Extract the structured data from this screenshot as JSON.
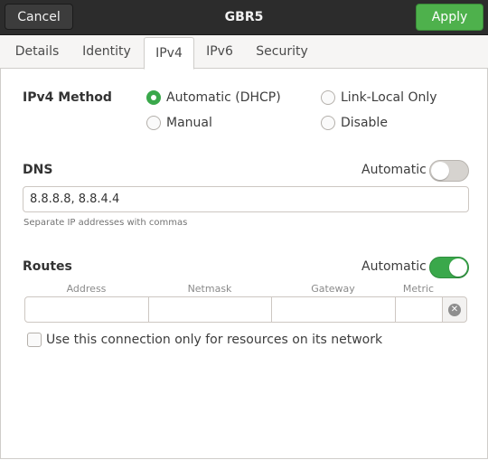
{
  "header": {
    "cancel_label": "Cancel",
    "title": "GBR5",
    "apply_label": "Apply"
  },
  "tabs": [
    {
      "label": "Details",
      "active": false
    },
    {
      "label": "Identity",
      "active": false
    },
    {
      "label": "IPv4",
      "active": true
    },
    {
      "label": "IPv6",
      "active": false
    },
    {
      "label": "Security",
      "active": false
    }
  ],
  "ipv4_method": {
    "label": "IPv4 Method",
    "options": [
      {
        "label": "Automatic (DHCP)",
        "selected": true
      },
      {
        "label": "Link-Local Only",
        "selected": false
      },
      {
        "label": "Manual",
        "selected": false
      },
      {
        "label": "Disable",
        "selected": false
      }
    ]
  },
  "dns": {
    "label": "DNS",
    "automatic_label": "Automatic",
    "automatic_on": false,
    "value": "8.8.8.8, 8.8.4.4",
    "hint": "Separate IP addresses with commas"
  },
  "routes": {
    "label": "Routes",
    "automatic_label": "Automatic",
    "automatic_on": true,
    "columns": [
      "Address",
      "Netmask",
      "Gateway",
      "Metric"
    ],
    "clear_icon": "clear-circle-icon"
  },
  "only_resources": {
    "label": "Use this connection only for resources on its network",
    "checked": false
  },
  "colors": {
    "accent_green": "#4eb14c",
    "titlebar": "#2c2c2c"
  }
}
